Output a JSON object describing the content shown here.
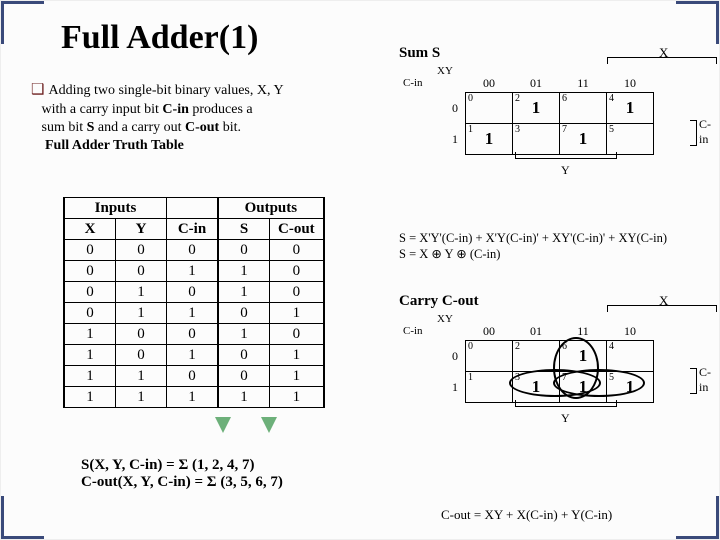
{
  "title": "Full Adder(1)",
  "desc_line1": "Adding two single-bit binary values, X, Y",
  "desc_line2": "with a carry input bit ",
  "desc_cin": "C-in",
  "desc_line2b": "  produces a",
  "desc_line3": "sum bit  ",
  "desc_s": "S",
  "desc_line3b": "  and a carry out ",
  "desc_cout": "C-out",
  "desc_line3c": " bit.",
  "desc_line4": "Full Adder Truth Table",
  "truth": {
    "hdr_inputs": "Inputs",
    "hdr_outputs": "Outputs",
    "cols": [
      "X",
      "Y",
      "C-in",
      "S",
      "C-out"
    ],
    "rows": [
      [
        "0",
        "0",
        "0",
        "0",
        "0"
      ],
      [
        "0",
        "0",
        "1",
        "1",
        "0"
      ],
      [
        "0",
        "1",
        "0",
        "1",
        "0"
      ],
      [
        "0",
        "1",
        "1",
        "0",
        "1"
      ],
      [
        "1",
        "0",
        "0",
        "1",
        "0"
      ],
      [
        "1",
        "0",
        "1",
        "0",
        "1"
      ],
      [
        "1",
        "1",
        "0",
        "0",
        "1"
      ],
      [
        "1",
        "1",
        "1",
        "1",
        "1"
      ]
    ]
  },
  "sum_sigma": "S(X, Y, C-in) = Σ (1, 2, 4, 7)",
  "cout_sigma": "C-out(X, Y, C-in) = Σ (3, 5, 6, 7)",
  "kmap_s": {
    "title": "Sum S",
    "xy": "XY",
    "cin": "C-in",
    "x": "X",
    "y": "Y",
    "cin_side": "C-in",
    "cols": [
      "00",
      "01",
      "11",
      "10"
    ],
    "row_hdrs": [
      "0",
      "1"
    ],
    "cells": [
      [
        {
          "m": "0",
          "v": ""
        },
        {
          "m": "2",
          "v": "1"
        },
        {
          "m": "6",
          "v": ""
        },
        {
          "m": "4",
          "v": "1"
        }
      ],
      [
        {
          "m": "1",
          "v": "1"
        },
        {
          "m": "3",
          "v": ""
        },
        {
          "m": "7",
          "v": "1"
        },
        {
          "m": "5",
          "v": ""
        }
      ]
    ],
    "eq1": "S =  X'Y'(C-in) + X'Y(C-in)' + XY'(C-in)' + XY(C-in)",
    "eq2": "S =  X  ⊕  Y  ⊕   (C-in)"
  },
  "kmap_c": {
    "title": "Carry C-out",
    "xy": "XY",
    "cin": "C-in",
    "x": "X",
    "y": "Y",
    "cin_side": "C-in",
    "cols": [
      "00",
      "01",
      "11",
      "10"
    ],
    "row_hdrs": [
      "0",
      "1"
    ],
    "cells": [
      [
        {
          "m": "0",
          "v": ""
        },
        {
          "m": "2",
          "v": ""
        },
        {
          "m": "6",
          "v": "1"
        },
        {
          "m": "4",
          "v": ""
        }
      ],
      [
        {
          "m": "1",
          "v": ""
        },
        {
          "m": "3",
          "v": "1"
        },
        {
          "m": "7",
          "v": "1"
        },
        {
          "m": "5",
          "v": "1"
        }
      ]
    ],
    "eq": "C-out =  XY + X(C-in) + Y(C-in)"
  }
}
